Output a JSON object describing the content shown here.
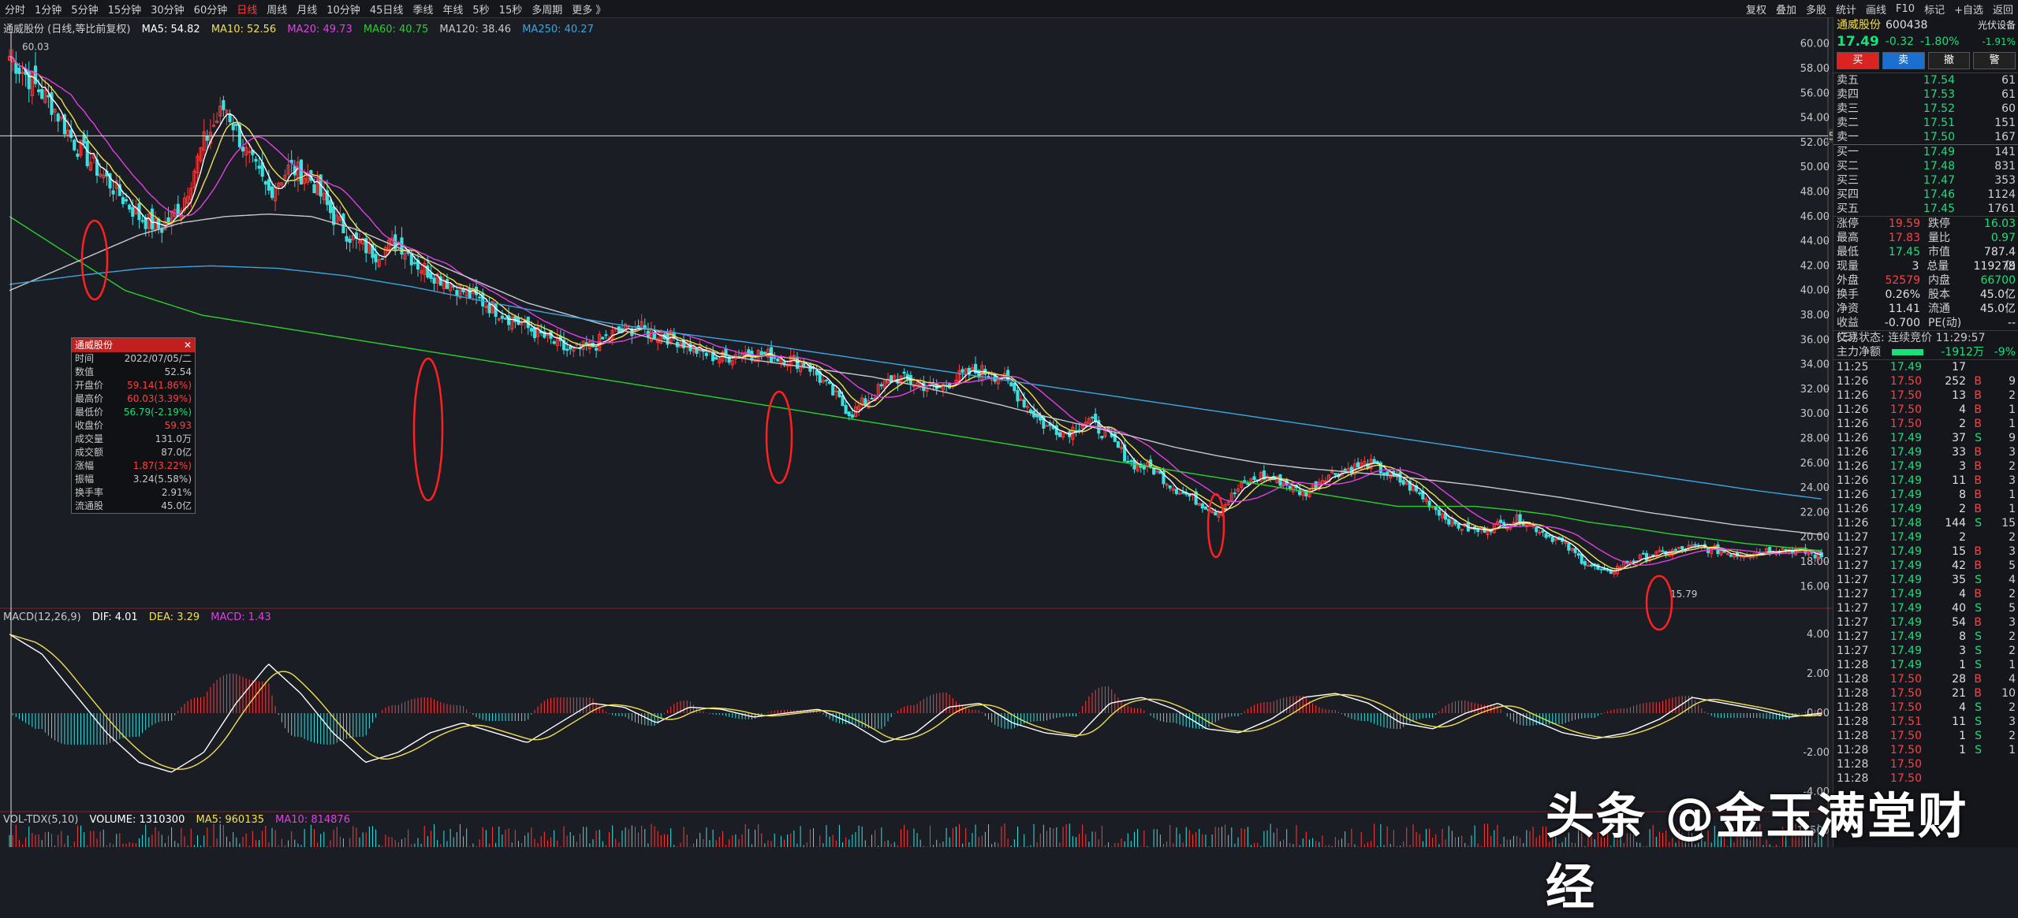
{
  "toolbar": {
    "periods": [
      "分时",
      "1分钟",
      "5分钟",
      "15分钟",
      "30分钟",
      "60分钟",
      "日线",
      "周线",
      "月线",
      "10分钟",
      "45日线",
      "季线",
      "年线",
      "5秒",
      "15秒",
      "多周期",
      "更多 》"
    ],
    "active_period": "日线",
    "right": [
      "复权",
      "叠加",
      "多股",
      "统计",
      "画线",
      "F10",
      "标记",
      "+自选",
      "返回"
    ]
  },
  "legend_main": {
    "title": "通威股份 (日线,等比前复权)",
    "ma5": "MA5: 54.82",
    "ma10": "MA10: 52.56",
    "ma20": "MA20: 49.73",
    "ma60": "MA60: 40.75",
    "ma120": "MA120: 38.46",
    "ma250": "MA250: 40.27"
  },
  "legend_macd": {
    "title": "MACD(12,26,9)",
    "dif": "DIF: 4.01",
    "dea": "DEA: 3.29",
    "macd": "MACD: 1.43"
  },
  "legend_vol": {
    "title": "VOL-TDX(5,10)",
    "volume": "VOLUME: 1310300",
    "ma5": "MA5: 960135",
    "ma10": "MA10: 814876"
  },
  "colors": {
    "ma5": "#ffffff",
    "ma10": "#f0e050",
    "ma20": "#e040e0",
    "ma60": "#2ad02a",
    "ma120": "#c8c8c8",
    "ma250": "#39a6e0",
    "up": "#ff3b3b",
    "down": "#39e0e0"
  },
  "chart_data": {
    "type": "candlestick",
    "price_ylim": [
      15.0,
      61.0
    ],
    "price_ticks": [
      "60.00",
      "58.00",
      "56.00",
      "54.00",
      "52.00",
      "50.00",
      "48.00",
      "46.00",
      "44.00",
      "42.00",
      "40.00",
      "38.00",
      "36.00",
      "34.00",
      "32.00",
      "30.00",
      "28.00",
      "26.00",
      "24.00",
      "22.00",
      "20.00",
      "18.00",
      "16.00"
    ],
    "crosshair_price": "52.54",
    "high_label": "60.03",
    "low_label": "15.79",
    "close_path": [
      59,
      57,
      55,
      52,
      50,
      48,
      46,
      45,
      47,
      52,
      55,
      51,
      48,
      50,
      49,
      46,
      44,
      43,
      44,
      42,
      41,
      40,
      39,
      38,
      37,
      36,
      35,
      35.5,
      36.5,
      37,
      36.5,
      36,
      35,
      34.5,
      35,
      34.8,
      34.5,
      34,
      32,
      30,
      31.5,
      33,
      32.5,
      32,
      33,
      33.5,
      33,
      31,
      29,
      28.5,
      29.5,
      28,
      26,
      25.5,
      24,
      23,
      22,
      24,
      25,
      24.5,
      23.5,
      25,
      25.5,
      26,
      25,
      24,
      22.5,
      21,
      20.5,
      21,
      21.5,
      20.5,
      19.5,
      18,
      17,
      18,
      18.5,
      18.8,
      19.2,
      19,
      18.6,
      18.8,
      19.1,
      18.9,
      18.4
    ],
    "ma60_path": [
      46,
      44,
      42,
      40,
      39,
      38,
      37.5,
      37,
      36.5,
      36,
      35.5,
      35,
      34.5,
      34,
      33.5,
      33,
      32.5,
      32,
      31.5,
      31,
      30.5,
      30,
      29.5,
      29,
      28.5,
      28,
      27.5,
      27,
      26.5,
      26,
      25.5,
      25,
      24.5,
      24,
      23.5,
      23,
      22.5,
      22.5,
      22.5,
      22.2,
      21.8,
      21.2,
      20.8,
      20.3,
      19.9,
      19.5,
      19.2,
      18.9
    ],
    "ma120_path": [
      40,
      41.5,
      43,
      44.5,
      45.5,
      46,
      46.2,
      46,
      45,
      43.5,
      42,
      40.5,
      39,
      38,
      37,
      36,
      35.2,
      34.5,
      34,
      33.5,
      33,
      32.3,
      31.5,
      30.7,
      29.8,
      29,
      28.2,
      27.3,
      26.6,
      26,
      25.6,
      25.3,
      25,
      24.6,
      24.2,
      23.7,
      23.2,
      22.6,
      22,
      21.5,
      21,
      20.6,
      20.2
    ],
    "ma250_path": [
      40.5,
      41.2,
      41.8,
      42,
      41.8,
      41.2,
      40.3,
      39.2,
      38.2,
      37.3,
      36.5,
      35.8,
      35,
      34.2,
      33.4,
      32.6,
      31.8,
      31,
      30.2,
      29.4,
      28.6,
      27.8,
      27,
      26.2,
      25.4,
      24.6,
      23.8,
      23.1
    ],
    "macd_ylim": [
      -4.8,
      4.8
    ],
    "macd_ticks": [
      "4.00",
      "2.00",
      "0.00",
      "-2.00",
      "-4.00"
    ],
    "macd_dif": [
      4,
      3,
      1,
      -1,
      -2.5,
      -3,
      -2,
      0.5,
      2.5,
      1,
      -1,
      -2.5,
      -2,
      -1,
      -0.5,
      -1,
      -1.5,
      -0.5,
      0.5,
      0.3,
      -0.5,
      0.3,
      0.2,
      -0.2,
      0,
      0.2,
      -0.5,
      -1.5,
      -1,
      0.3,
      0.5,
      -0.5,
      -1,
      -1.2,
      0.5,
      0.8,
      0.2,
      -0.8,
      -1,
      -0.3,
      0.8,
      1,
      0.5,
      -0.5,
      -0.8,
      0,
      0.5,
      -0.3,
      -1,
      -1.3,
      -1,
      -0.3,
      0.8,
      0.5,
      0.2,
      -0.2,
      0
    ],
    "vol_tick": "17500"
  },
  "tooltip": {
    "title": "通威股份",
    "rows": [
      [
        "时间",
        "2022/07/05/二"
      ],
      [
        "数值",
        "52.54"
      ],
      [
        "开盘价",
        "59.14(1.86%)"
      ],
      [
        "最高价",
        "60.03(3.39%)"
      ],
      [
        "最低价",
        "56.79(-2.19%)"
      ],
      [
        "收盘价",
        "59.93"
      ],
      [
        "成交量",
        "131.0万"
      ],
      [
        "成交额",
        "87.0亿"
      ],
      [
        "涨幅",
        "1.87(3.22%)"
      ],
      [
        "振幅",
        "3.24(5.58%)"
      ],
      [
        "换手率",
        "2.91%"
      ],
      [
        "流通股",
        "45.0亿"
      ]
    ]
  },
  "panel": {
    "name": "通威股份",
    "code": "600438",
    "sector": "光伏设备",
    "price": "17.49",
    "change": "-0.32",
    "pct": "-1.80%",
    "sector_pct": "-1.91%",
    "buttons": [
      "买",
      "卖",
      "撤",
      "警"
    ],
    "asks": [
      [
        "卖五",
        "17.54",
        "61"
      ],
      [
        "卖四",
        "17.53",
        "61"
      ],
      [
        "卖三",
        "17.52",
        "60"
      ],
      [
        "卖二",
        "17.51",
        "151"
      ],
      [
        "卖一",
        "17.50",
        "167"
      ]
    ],
    "bids": [
      [
        "买一",
        "17.49",
        "141"
      ],
      [
        "买二",
        "17.48",
        "831"
      ],
      [
        "买三",
        "17.47",
        "353"
      ],
      [
        "买四",
        "17.46",
        "1124"
      ],
      [
        "买五",
        "17.45",
        "1761"
      ]
    ],
    "stats": [
      [
        "涨停",
        "19.59",
        "跌停",
        "16.03"
      ],
      [
        "最高",
        "17.83",
        "量比",
        "0.97"
      ],
      [
        "最低",
        "17.45",
        "市值",
        "787.4亿"
      ],
      [
        "现量",
        "3",
        "总量",
        "119279"
      ],
      [
        "外盘",
        "52579",
        "内盘",
        "66700"
      ],
      [
        "换手",
        "0.26%",
        "股本",
        "45.0亿"
      ],
      [
        "净资",
        "11.41",
        "流通",
        "45.0亿"
      ],
      [
        "收益(三)",
        "-0.700",
        "PE(动)",
        "--"
      ]
    ],
    "status": "交易状态: 连续竞价 11:29:57",
    "flow_label": "主力净额",
    "flow_value": "-1912万",
    "flow_pct": "-9%",
    "ticks": [
      [
        "11:25",
        "17.49",
        "17",
        "",
        ""
      ],
      [
        "11:26",
        "17.50",
        "252",
        "B",
        "9"
      ],
      [
        "11:26",
        "17.50",
        "13",
        "B",
        "2"
      ],
      [
        "11:26",
        "17.50",
        "4",
        "B",
        "1"
      ],
      [
        "11:26",
        "17.50",
        "2",
        "B",
        "1"
      ],
      [
        "11:26",
        "17.49",
        "37",
        "S",
        "9"
      ],
      [
        "11:26",
        "17.49",
        "33",
        "B",
        "3"
      ],
      [
        "11:26",
        "17.49",
        "3",
        "B",
        "2"
      ],
      [
        "11:26",
        "17.49",
        "11",
        "B",
        "3"
      ],
      [
        "11:26",
        "17.49",
        "8",
        "B",
        "1"
      ],
      [
        "11:26",
        "17.49",
        "2",
        "B",
        "1"
      ],
      [
        "11:26",
        "17.48",
        "144",
        "S",
        "15"
      ],
      [
        "11:27",
        "17.49",
        "2",
        "",
        "2"
      ],
      [
        "11:27",
        "17.49",
        "15",
        "B",
        "3"
      ],
      [
        "11:27",
        "17.49",
        "42",
        "B",
        "5"
      ],
      [
        "11:27",
        "17.49",
        "35",
        "S",
        "4"
      ],
      [
        "11:27",
        "17.49",
        "4",
        "B",
        "2"
      ],
      [
        "11:27",
        "17.49",
        "40",
        "S",
        "5"
      ],
      [
        "11:27",
        "17.49",
        "54",
        "B",
        "3"
      ],
      [
        "11:27",
        "17.49",
        "8",
        "S",
        "2"
      ],
      [
        "11:27",
        "17.49",
        "3",
        "S",
        "2"
      ],
      [
        "11:28",
        "17.49",
        "1",
        "S",
        "1"
      ],
      [
        "11:28",
        "17.50",
        "28",
        "B",
        "4"
      ],
      [
        "11:28",
        "17.50",
        "21",
        "B",
        "10"
      ],
      [
        "11:28",
        "17.50",
        "4",
        "S",
        "2"
      ],
      [
        "11:28",
        "17.51",
        "11",
        "S",
        "3"
      ],
      [
        "11:28",
        "17.50",
        "1",
        "S",
        "2"
      ],
      [
        "11:28",
        "17.50",
        "1",
        "S",
        "1"
      ],
      [
        "11:28",
        "17.50",
        "",
        "",
        ""
      ],
      [
        "11:28",
        "17.50",
        "",
        "",
        ""
      ]
    ]
  },
  "watermark": "头条 @金玉满堂财经"
}
